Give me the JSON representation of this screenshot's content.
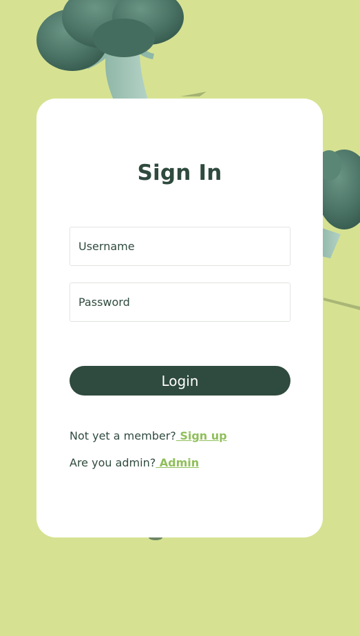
{
  "colors": {
    "background": "#d6e292",
    "card": "#ffffff",
    "primary": "#2f4a3e",
    "link": "#8fbf5a",
    "broccoli": "#4f7a6b"
  },
  "signin": {
    "title": "Sign In",
    "username_placeholder": "Username",
    "password_placeholder": "Password",
    "login_label": "Login",
    "member_prompt": "Not yet a member?",
    "signup_link": " Sign up",
    "admin_prompt": "Are you admin?",
    "admin_link": " Admin"
  },
  "decorations": [
    "broccoli-top",
    "broccoli-right"
  ]
}
